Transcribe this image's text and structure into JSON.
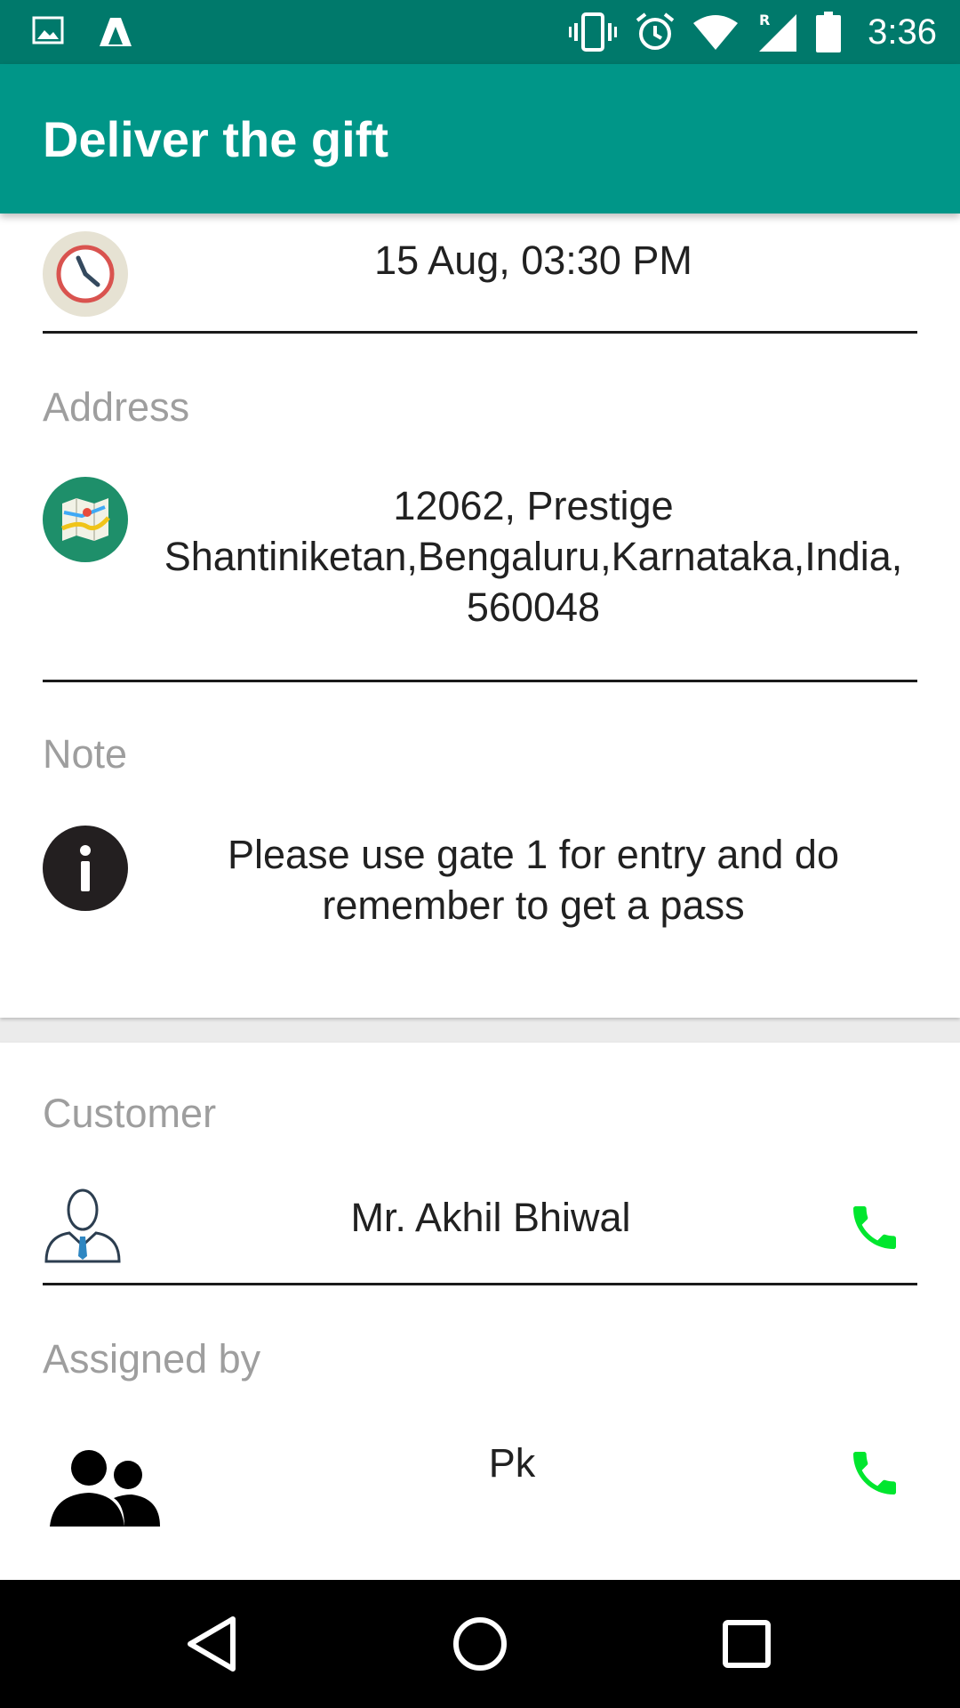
{
  "status_bar": {
    "time": "3:36",
    "left_icons": [
      "image-icon",
      "app-icon"
    ],
    "right_icons": [
      "vibrate-icon",
      "alarm-icon",
      "wifi-icon",
      "signal-roaming-icon",
      "battery-icon"
    ]
  },
  "app_bar": {
    "title": "Deliver the gift"
  },
  "delivery": {
    "datetime": "15 Aug, 03:30 PM",
    "address_label": "Address",
    "address": "12062, Prestige Shantiniketan,Bengaluru,Karnataka,India, 560048",
    "note_label": "Note",
    "note": "Please use gate 1 for entry and do remember to get a pass"
  },
  "contacts": {
    "customer_label": "Customer",
    "customer_name": "Mr. Akhil Bhiwal",
    "assigned_label": "Assigned by",
    "assigned_name": "Pk"
  },
  "colors": {
    "status_bar": "#00796b",
    "app_bar": "#009688",
    "phone_green": "#00e62e",
    "label_gray": "#9e9e9e"
  },
  "nav_bar": {
    "buttons": [
      "back-icon",
      "home-icon",
      "recents-icon"
    ]
  }
}
